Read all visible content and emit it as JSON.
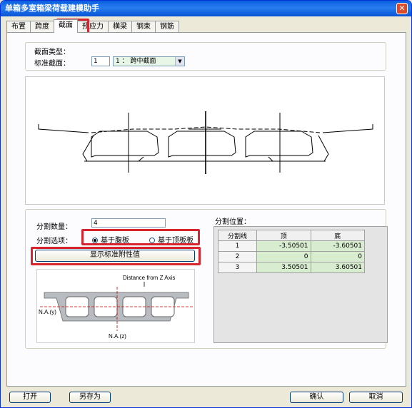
{
  "window": {
    "title": "单箱多室箱梁荷载建模助手"
  },
  "tabs": [
    "布置",
    "跨度",
    "截面",
    "预应力",
    "横梁",
    "钢束",
    "钢筋"
  ],
  "section": {
    "type_label": "截面类型：",
    "standard_label": "标准截面：",
    "index_value": "1",
    "combo_value": "1 ： 跨中截面"
  },
  "division": {
    "count_label": "分割数量：",
    "count_value": "4",
    "option_label": "分割选项：",
    "option_web": "基于腹板",
    "option_top": "基于顶板板",
    "show_button": "显示标准附性值"
  },
  "results": {
    "title": "分割位置：",
    "headers": [
      "分割线",
      "顶",
      "底"
    ],
    "rows": [
      [
        "1",
        "-3.50501",
        "-3.60501"
      ],
      [
        "2",
        "0",
        "0"
      ],
      [
        "3",
        "3.50501",
        "3.60501"
      ]
    ]
  },
  "thumb": {
    "distance_label": "Distance from Z Axis",
    "na_y_label": "N.A.(y)",
    "na_z_label": "N.A.(z)"
  },
  "footer": {
    "open": "打开",
    "save_as": "另存为",
    "ok": "确认",
    "cancel": "取消"
  }
}
